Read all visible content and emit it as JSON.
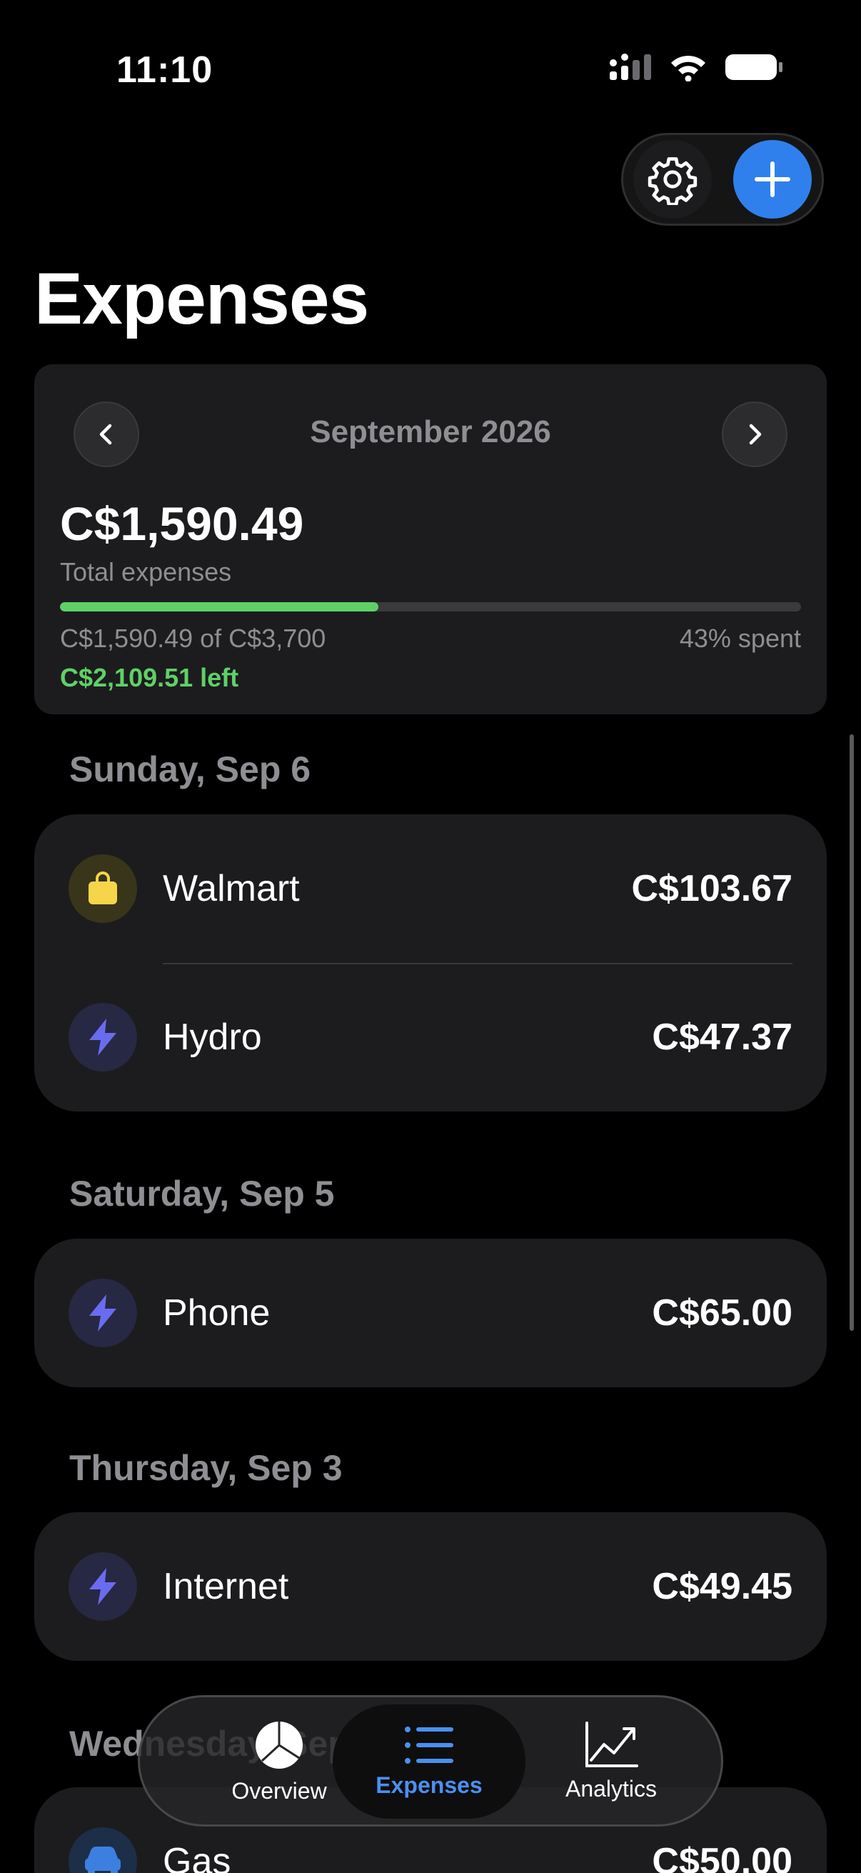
{
  "status_bar": {
    "time": "11:10"
  },
  "header": {
    "title": "Expenses"
  },
  "summary": {
    "month": "September 2026",
    "total": "C$1,590.49",
    "total_label": "Total expenses",
    "progress_percent": 43,
    "budget_text": "C$1,590.49 of C$3,700",
    "percent_text": "43% spent",
    "left_text": "C$2,109.51 left"
  },
  "days": [
    {
      "header": "Sunday, Sep 6",
      "items": [
        {
          "name": "Walmart",
          "amount": "C$103.67",
          "icon": "shopping-bag-icon"
        },
        {
          "name": "Hydro",
          "amount": "C$47.37",
          "icon": "lightning-bolt-icon"
        }
      ]
    },
    {
      "header": "Saturday, Sep 5",
      "items": [
        {
          "name": "Phone",
          "amount": "C$65.00",
          "icon": "lightning-bolt-icon"
        }
      ]
    },
    {
      "header": "Thursday, Sep 3",
      "items": [
        {
          "name": "Internet",
          "amount": "C$49.45",
          "icon": "lightning-bolt-icon"
        }
      ]
    },
    {
      "header": "Wednesday, Sep 2",
      "items": [
        {
          "name": "Gas",
          "amount": "C$50.00",
          "icon": "car-icon"
        }
      ]
    }
  ],
  "tabs": [
    {
      "label": "Overview",
      "icon": "pie-chart-icon"
    },
    {
      "label": "Expenses",
      "icon": "list-icon"
    },
    {
      "label": "Analytics",
      "icon": "trend-chart-icon"
    }
  ],
  "colors": {
    "accent_blue": "#2f80ed",
    "progress_green": "#5fd068",
    "shopping_yellow": "#f7d54a",
    "utility_purple": "#6a6cf0",
    "auto_blue": "#3d7fe0"
  }
}
